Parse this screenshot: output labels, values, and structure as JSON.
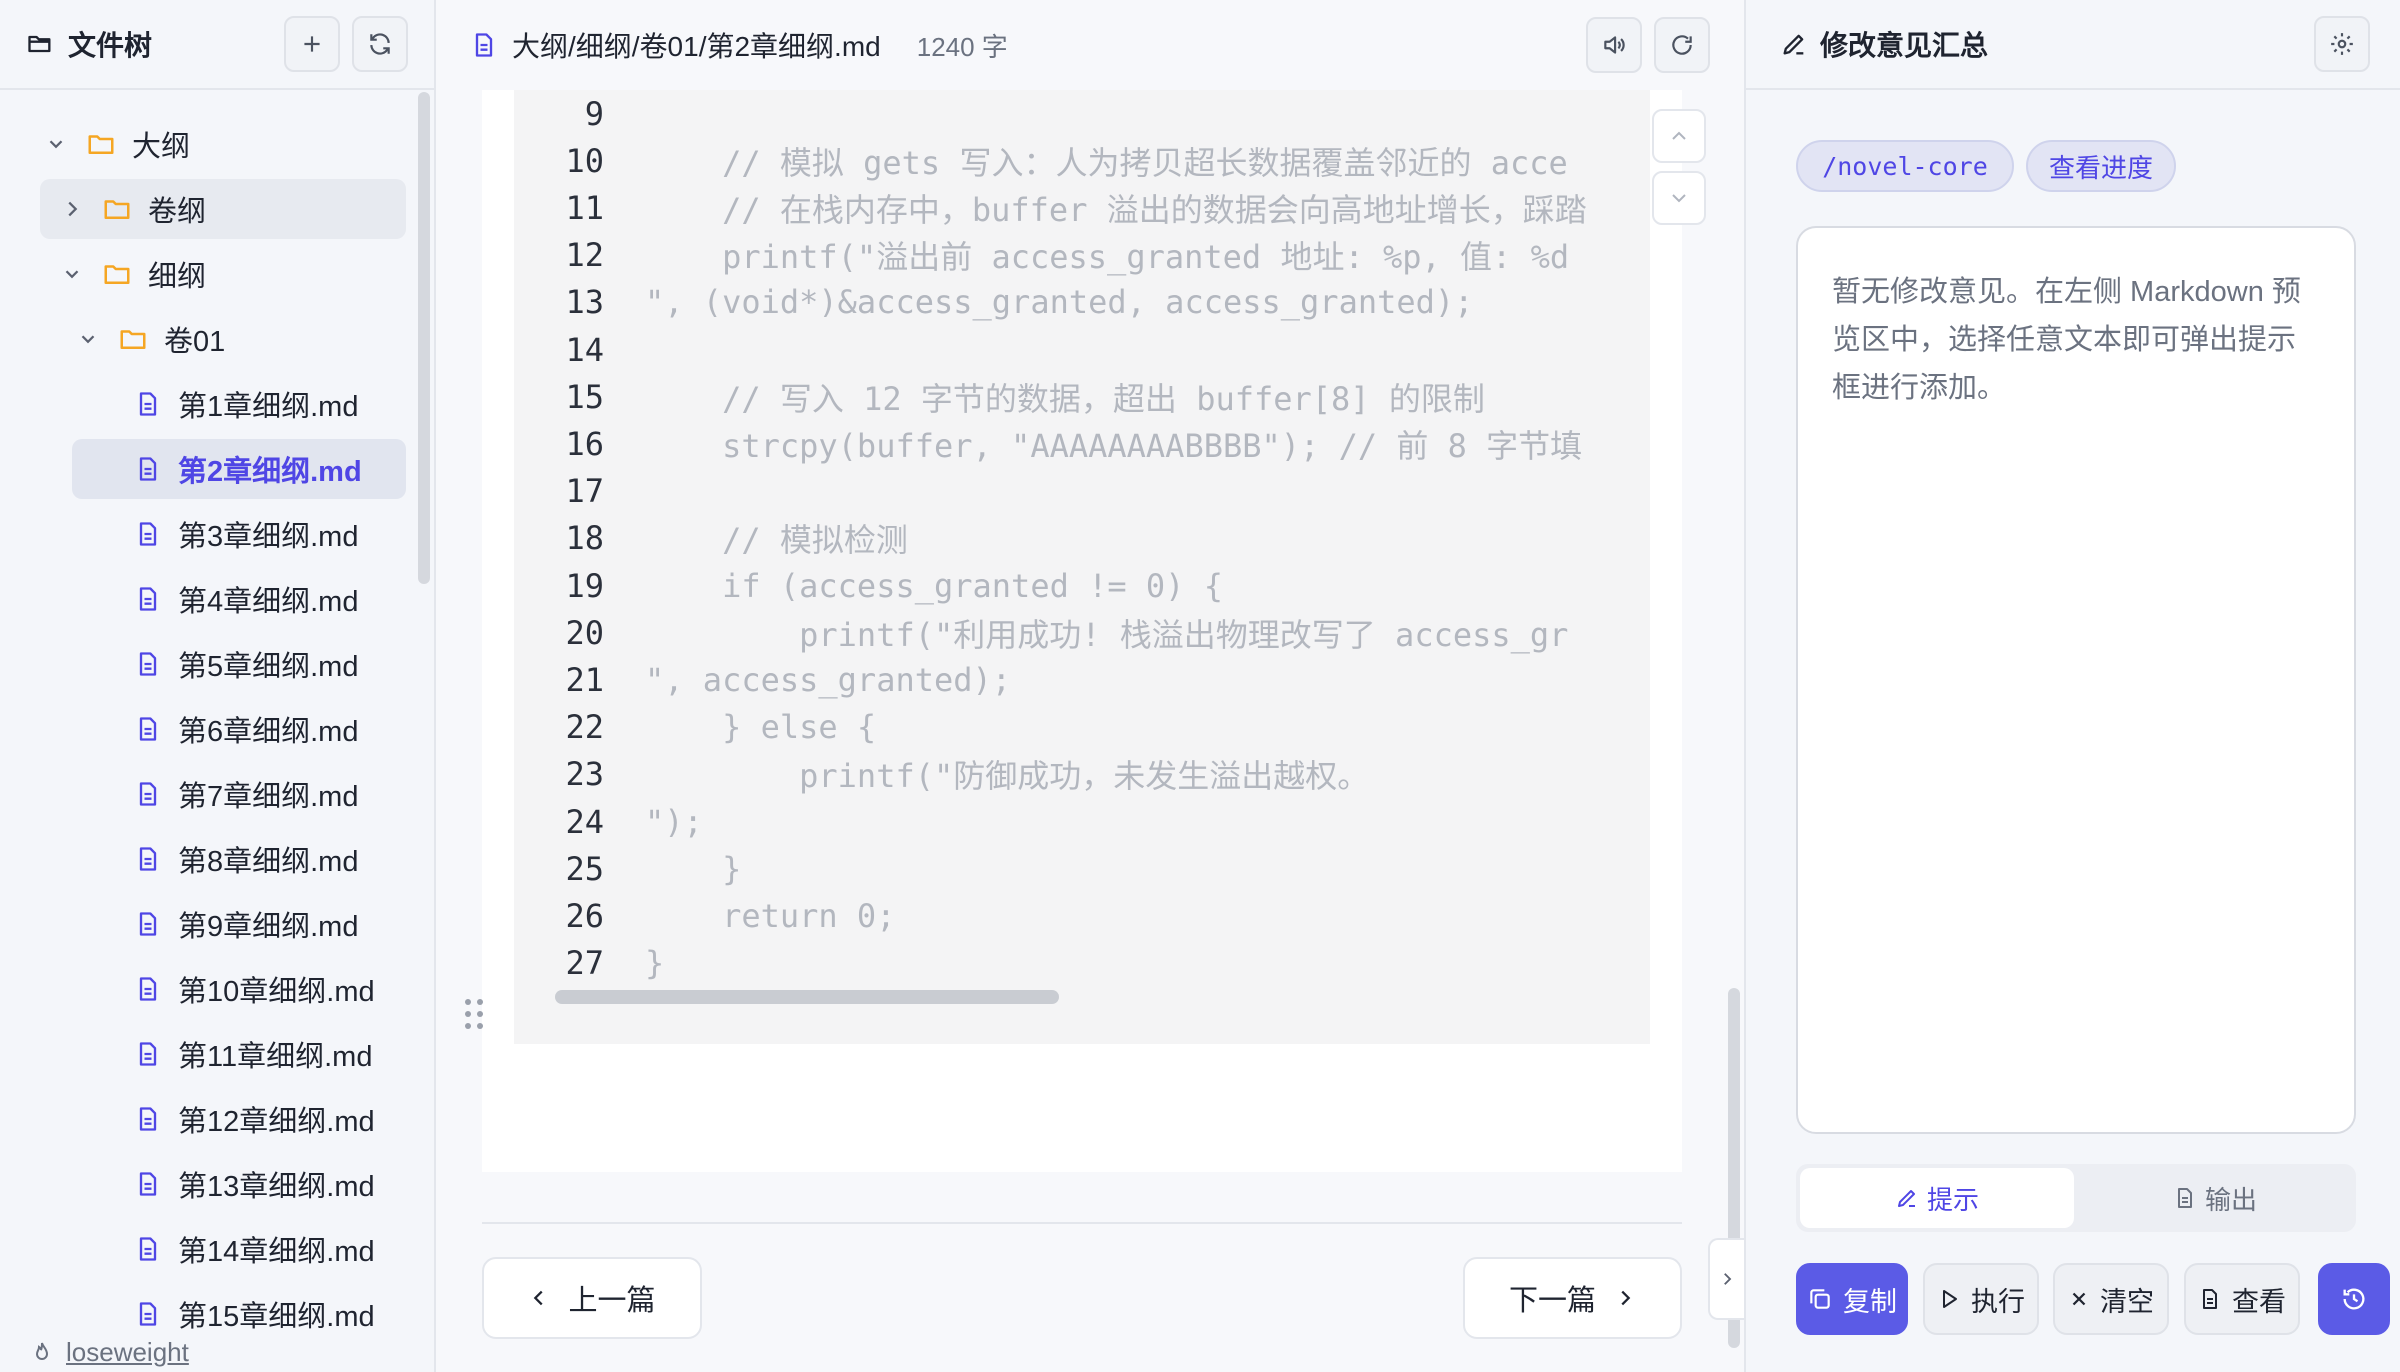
{
  "sidebar": {
    "title": "文件树",
    "tree": [
      {
        "label": "大纲",
        "type": "folder",
        "expanded": true,
        "depth": 0
      },
      {
        "label": "卷纲",
        "type": "folder",
        "expanded": false,
        "depth": 1
      },
      {
        "label": "细纲",
        "type": "folder",
        "expanded": true,
        "depth": 1
      },
      {
        "label": "卷01",
        "type": "folder",
        "expanded": true,
        "depth": 2
      },
      {
        "label": "第1章细纲.md",
        "type": "file",
        "depth": 3
      },
      {
        "label": "第2章细纲.md",
        "type": "file",
        "depth": 3,
        "active": true
      },
      {
        "label": "第3章细纲.md",
        "type": "file",
        "depth": 3
      },
      {
        "label": "第4章细纲.md",
        "type": "file",
        "depth": 3
      },
      {
        "label": "第5章细纲.md",
        "type": "file",
        "depth": 3
      },
      {
        "label": "第6章细纲.md",
        "type": "file",
        "depth": 3
      },
      {
        "label": "第7章细纲.md",
        "type": "file",
        "depth": 3
      },
      {
        "label": "第8章细纲.md",
        "type": "file",
        "depth": 3
      },
      {
        "label": "第9章细纲.md",
        "type": "file",
        "depth": 3
      },
      {
        "label": "第10章细纲.md",
        "type": "file",
        "depth": 3
      },
      {
        "label": "第11章细纲.md",
        "type": "file",
        "depth": 3
      },
      {
        "label": "第12章细纲.md",
        "type": "file",
        "depth": 3
      },
      {
        "label": "第13章细纲.md",
        "type": "file",
        "depth": 3
      },
      {
        "label": "第14章细纲.md",
        "type": "file",
        "depth": 3
      },
      {
        "label": "第15章细纲.md",
        "type": "file",
        "depth": 3
      }
    ],
    "footer_link": "loseweight"
  },
  "editor": {
    "path": "大纲/细纲/卷01/第2章细纲.md",
    "word_count": "1240 字",
    "code_lines": [
      {
        "n": "9",
        "text": ""
      },
      {
        "n": "10",
        "text": "    // 模拟 gets 写入：人为拷贝超长数据覆盖邻近的 acce"
      },
      {
        "n": "11",
        "text": "    // 在栈内存中，buffer 溢出的数据会向高地址增长，踩踏"
      },
      {
        "n": "12",
        "text": "    printf(\"溢出前 access_granted 地址: %p, 值: %d"
      },
      {
        "n": "13",
        "text": "\", (void*)&access_granted, access_granted);"
      },
      {
        "n": "14",
        "text": ""
      },
      {
        "n": "15",
        "text": "    // 写入 12 字节的数据，超出 buffer[8] 的限制"
      },
      {
        "n": "16",
        "text": "    strcpy(buffer, \"AAAAAAAABBBB\"); // 前 8 字节填"
      },
      {
        "n": "17",
        "text": ""
      },
      {
        "n": "18",
        "text": "    // 模拟检测"
      },
      {
        "n": "19",
        "text": "    if (access_granted != 0) {"
      },
      {
        "n": "20",
        "text": "        printf(\"利用成功! 栈溢出物理改写了 access_gr"
      },
      {
        "n": "21",
        "text": "\", access_granted);"
      },
      {
        "n": "22",
        "text": "    } else {"
      },
      {
        "n": "23",
        "text": "        printf(\"防御成功，未发生溢出越权。"
      },
      {
        "n": "24",
        "text": "\");"
      },
      {
        "n": "25",
        "text": "    }"
      },
      {
        "n": "26",
        "text": "    return 0;"
      },
      {
        "n": "27",
        "text": "}"
      }
    ],
    "prev_label": "上一篇",
    "next_label": "下一篇"
  },
  "panel": {
    "title": "修改意见汇总",
    "tags": [
      "/novel-core",
      "查看进度"
    ],
    "empty_text": "暂无修改意见。在左侧 Markdown 预览区中，选择任意文本即可弹出提示框进行添加。",
    "tabs": [
      {
        "label": "提示",
        "icon": "pencil-icon",
        "active": true
      },
      {
        "label": "输出",
        "icon": "file-icon",
        "active": false
      }
    ],
    "actions": [
      {
        "label": "复制",
        "icon": "copy-icon",
        "primary": true
      },
      {
        "label": "执行",
        "icon": "play-icon"
      },
      {
        "label": "清空",
        "icon": "close-icon"
      },
      {
        "label": "查看",
        "icon": "file-icon"
      }
    ]
  },
  "colors": {
    "accent": "#4f46e5",
    "folder": "#f5a623",
    "file": "#4f46e5"
  }
}
